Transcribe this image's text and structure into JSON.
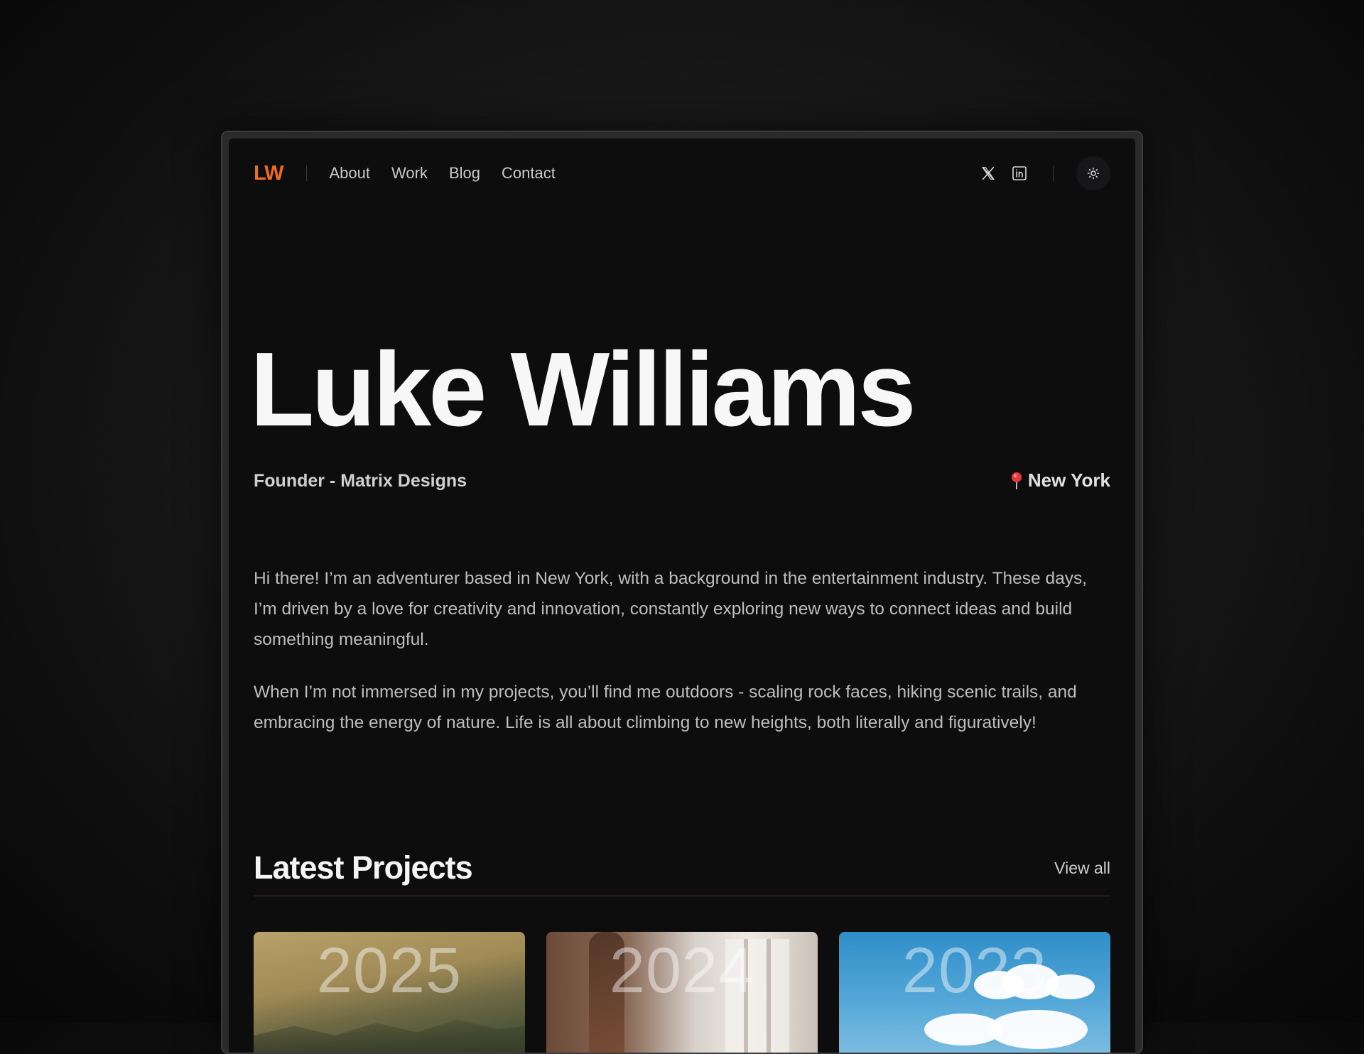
{
  "nav": {
    "logo": "LW",
    "links": [
      "About",
      "Work",
      "Blog",
      "Contact"
    ]
  },
  "social": {
    "x_icon": "x-icon",
    "linkedin_icon": "linkedin-icon",
    "theme_icon": "sun-icon"
  },
  "hero": {
    "name": "Luke Williams",
    "role": "Founder - Matrix Designs",
    "location": "New York",
    "location_icon": "map-pin-icon"
  },
  "bio": {
    "paragraphs": [
      "Hi there! I’m an adventurer based in New York, with a background in the entertainment industry. These days, I’m driven by a love for creativity and innovation, constantly exploring new ways to connect ideas and build something meaningful.",
      "When I’m not immersed in my projects, you’ll find me outdoors - scaling rock faces, hiking scenic trails, and embracing the energy of nature. Life is all about climbing to new heights, both literally and figuratively!"
    ]
  },
  "projects": {
    "title": "Latest Projects",
    "view_all": "View all",
    "cards": [
      {
        "year": "2025"
      },
      {
        "year": "2024"
      },
      {
        "year": "2023"
      }
    ]
  },
  "colors": {
    "accent": "#f26a1b",
    "background": "#0d0d0e",
    "divider": "#5a2b1c"
  }
}
